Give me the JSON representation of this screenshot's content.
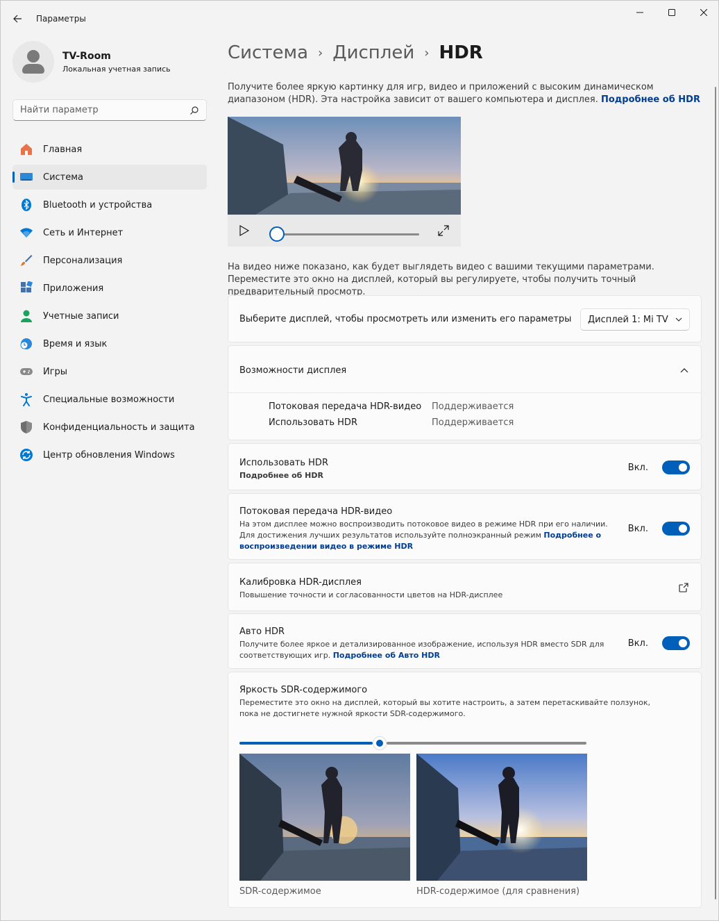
{
  "window": {
    "title": "Параметры",
    "back_icon": "arrow-left-icon",
    "controls": [
      "minimize-icon",
      "maximize-icon",
      "close-icon"
    ]
  },
  "user": {
    "name": "TV-Room",
    "account": "Локальная учетная запись"
  },
  "search": {
    "placeholder": "Найти параметр"
  },
  "sidebar": {
    "items": [
      {
        "label": "Главная",
        "icon": "home-icon",
        "color": "#e8734a"
      },
      {
        "label": "Система",
        "icon": "system-icon",
        "color": "#2b88d8",
        "active": true
      },
      {
        "label": "Bluetooth и устройства",
        "icon": "bluetooth-icon",
        "color": "#0078d4"
      },
      {
        "label": "Сеть и Интернет",
        "icon": "wifi-icon",
        "color": "#0078d4"
      },
      {
        "label": "Персонализация",
        "icon": "brush-icon",
        "color": "#d97b2b"
      },
      {
        "label": "Приложения",
        "icon": "apps-icon",
        "color": "#4a6fa5"
      },
      {
        "label": "Учетные записи",
        "icon": "person-icon",
        "color": "#1aa260"
      },
      {
        "label": "Время и язык",
        "icon": "clock-globe-icon",
        "color": "#2b88d8"
      },
      {
        "label": "Игры",
        "icon": "gamepad-icon",
        "color": "#7a7a7a"
      },
      {
        "label": "Специальные возможности",
        "icon": "accessibility-icon",
        "color": "#0078d4"
      },
      {
        "label": "Конфиденциальность и защита",
        "icon": "shield-icon",
        "color": "#6e6e6e"
      },
      {
        "label": "Центр обновления Windows",
        "icon": "update-icon",
        "color": "#0078d4"
      }
    ]
  },
  "breadcrumb": {
    "items": [
      "Система",
      "Дисплей"
    ],
    "current": "HDR"
  },
  "intro": {
    "text": "Получите более яркую картинку для игр, видео и приложений с высоким динамическом диапазоном (HDR). Эта настройка зависит от вашего компьютера и дисплея.",
    "link": "Подробнее об HDR"
  },
  "player": {
    "progress": 0
  },
  "preview_note": "На видео ниже показано, как будет выглядеть видео с вашими текущими параметрами. Переместите это окно на дисплей, который вы регулируете, чтобы получить точный предварительный просмотр.",
  "display_select": {
    "label": "Выберите дисплей, чтобы просмотреть или изменить его параметры",
    "value": "Дисплей 1: Mi TV"
  },
  "capabilities": {
    "title": "Возможности дисплея",
    "rows": [
      {
        "name": "Потоковая передача HDR-видео",
        "value": "Поддерживается"
      },
      {
        "name": "Использовать HDR",
        "value": "Поддерживается"
      }
    ]
  },
  "use_hdr": {
    "title": "Использовать HDR",
    "link": "Подробнее об HDR",
    "state": "Вкл."
  },
  "hdr_streaming": {
    "title": "Потоковая передача HDR-видео",
    "sub": "На этом дисплее можно воспроизводить потоковое видео в режиме HDR при его наличии. Для достижения лучших результатов используйте полноэкранный режим",
    "link": "Подробнее о воспроизведении видео в режиме HDR",
    "state": "Вкл."
  },
  "calibration": {
    "title": "Калибровка HDR-дисплея",
    "sub": "Повышение точности и согласованности цветов на HDR-дисплее"
  },
  "auto_hdr": {
    "title": "Авто HDR",
    "sub": "Получите более яркое и детализированное изображение, используя HDR вместо SDR для соответствующих игр.",
    "link": "Подробнее об Авто HDR",
    "state": "Вкл."
  },
  "sdr_brightness": {
    "title": "Яркость SDR-содержимого",
    "sub": "Переместите это окно на дисплей, который вы хотите настроить, а затем перетаскивайте ползунок, пока не достигнете нужной яркости SDR-содержимого.",
    "slider_fraction": 0.4,
    "sdr_caption": "SDR-содержимое",
    "hdr_caption": "HDR-содержимое (для сравнения)"
  },
  "colors": {
    "accent": "#005fb8",
    "link": "#003e92"
  }
}
